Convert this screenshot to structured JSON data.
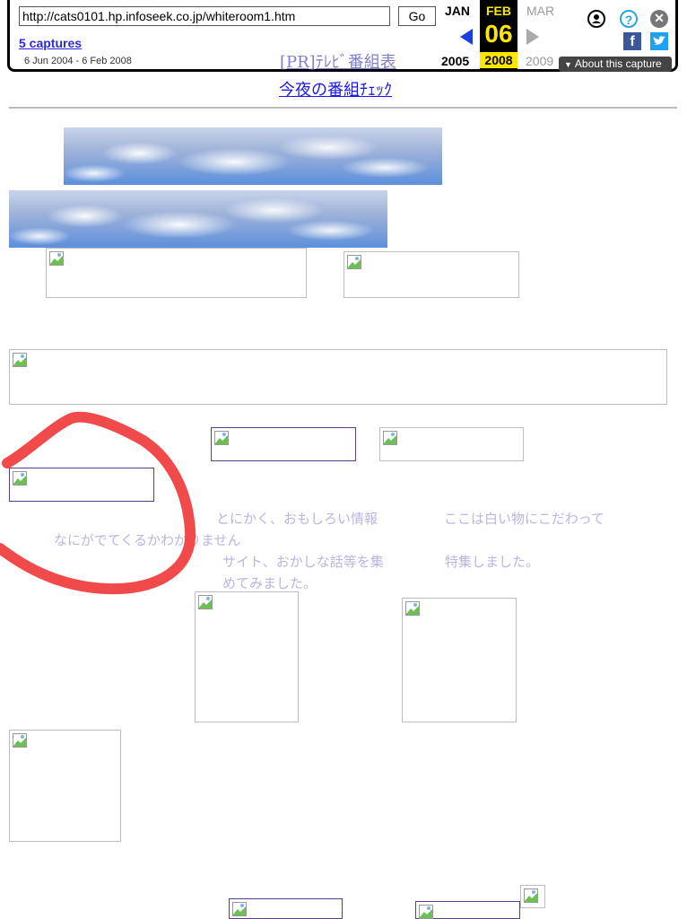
{
  "wayback": {
    "url": "http://cats0101.hp.infoseek.co.jp/whiteroom1.htm",
    "go_label": "Go",
    "captures_label": "5 captures",
    "date_range": "6 Jun 2004 - 6 Feb 2008",
    "prev_month": "JAN",
    "current_month": "FEB",
    "next_month": "MAR",
    "day": "06",
    "prev_year": "2005",
    "current_year": "2008",
    "next_year": "2009",
    "about_label": "About this capture",
    "colors": {
      "accent": "#1a3fe0",
      "highlight": "#ffe600",
      "facebook": "#3b5998",
      "twitter": "#1da1f2"
    }
  },
  "page": {
    "pr_link": "[PR]ﾃﾚﾋﾞ番組表",
    "tv_link": "今夜の番組ﾁｪｯｸ",
    "text_col1": "なにがでてくるかわかりません",
    "text_col2_line1": "とにかく、おもしろい情報",
    "text_col2_line2": "サイト、おかしな話等を集",
    "text_col2_line3": "めてみました。",
    "text_col3_line1": "ここは白い物にこだわって",
    "text_col3_line2": "特集しました。",
    "text_color": "#b9b6df",
    "annotation_color": "#f04a4a"
  }
}
